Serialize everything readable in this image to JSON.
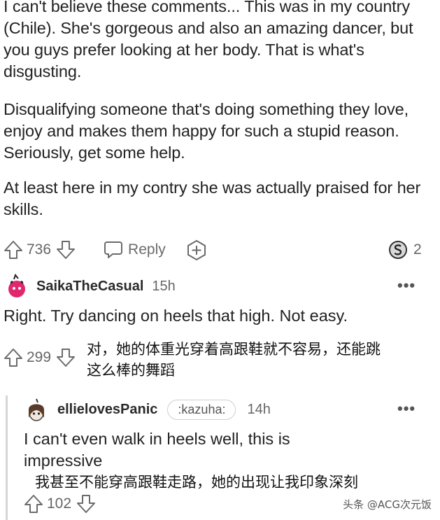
{
  "post": {
    "paragraphs": [
      "I can't believe these comments... This was in my country (Chile). She's gorgeous and also an amazing dancer, but you guys prefer looking at her body. That is what's disgusting.",
      "Disqualifying someone that's doing something they love, enjoy and makes them happy for such a stupid reason. Seriously, get some help.",
      "At least here in my contry she was actually praised for her skills."
    ],
    "votes": "736",
    "reply_label": "Reply",
    "award_count": "2"
  },
  "comment1": {
    "username": "SaikaTheCasual",
    "time": "15h",
    "more": "•••",
    "text": "Right. Try dancing on heels that high. Not easy.",
    "votes": "299",
    "translation_line1": "对，她的体重光穿着高跟鞋就不容易，还能跳",
    "translation_line2": "这么棒的舞蹈"
  },
  "comment2": {
    "username": "ellielovesPanic",
    "flair": ":kazuha:",
    "time": "14h",
    "more": "•••",
    "text_line1": "I can't even walk in heels well, this is",
    "text_line2": "impressive",
    "votes": "102",
    "translation": "我甚至不能穿高跟鞋走路，她的出现让我印象深刻"
  },
  "watermark": "头条 @ACG次元饭",
  "colors": {
    "text": "#222222",
    "muted": "#6b6b6b",
    "avatar1": "#e0286f",
    "thread": "#d6d6d6"
  }
}
